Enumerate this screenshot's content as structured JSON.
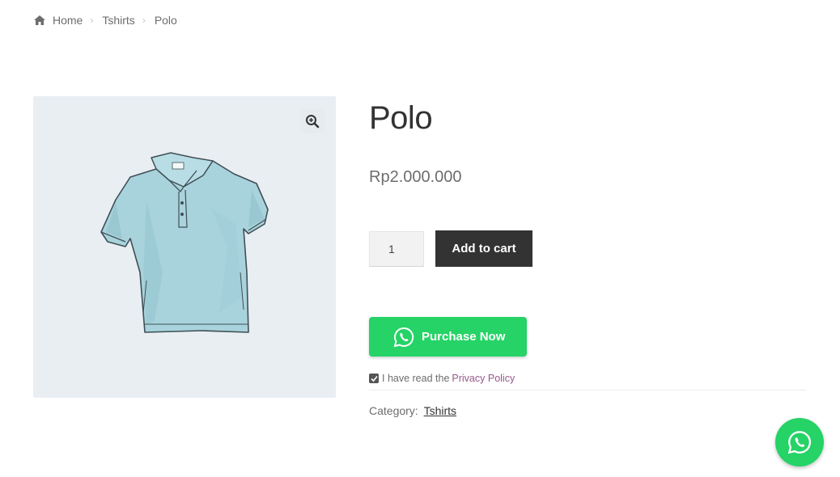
{
  "breadcrumb": {
    "home": "Home",
    "category": "Tshirts",
    "current": "Polo",
    "separator": "›"
  },
  "product": {
    "title": "Polo",
    "price": "Rp2.000.000",
    "quantity": "1",
    "add_to_cart_label": "Add to cart",
    "purchase_label": "Purchase Now",
    "policy_prefix": "I have read the",
    "policy_link": "Privacy Policy",
    "policy_checked": true,
    "category_label": "Category:",
    "category_value": "Tshirts"
  },
  "icons": {
    "home": "home-icon",
    "zoom": "zoom-in-icon",
    "whatsapp": "whatsapp-icon"
  },
  "colors": {
    "whatsapp_green": "#25d366",
    "button_dark": "#333333",
    "link_purple": "#96588a",
    "gallery_bg": "#e9eef3"
  }
}
